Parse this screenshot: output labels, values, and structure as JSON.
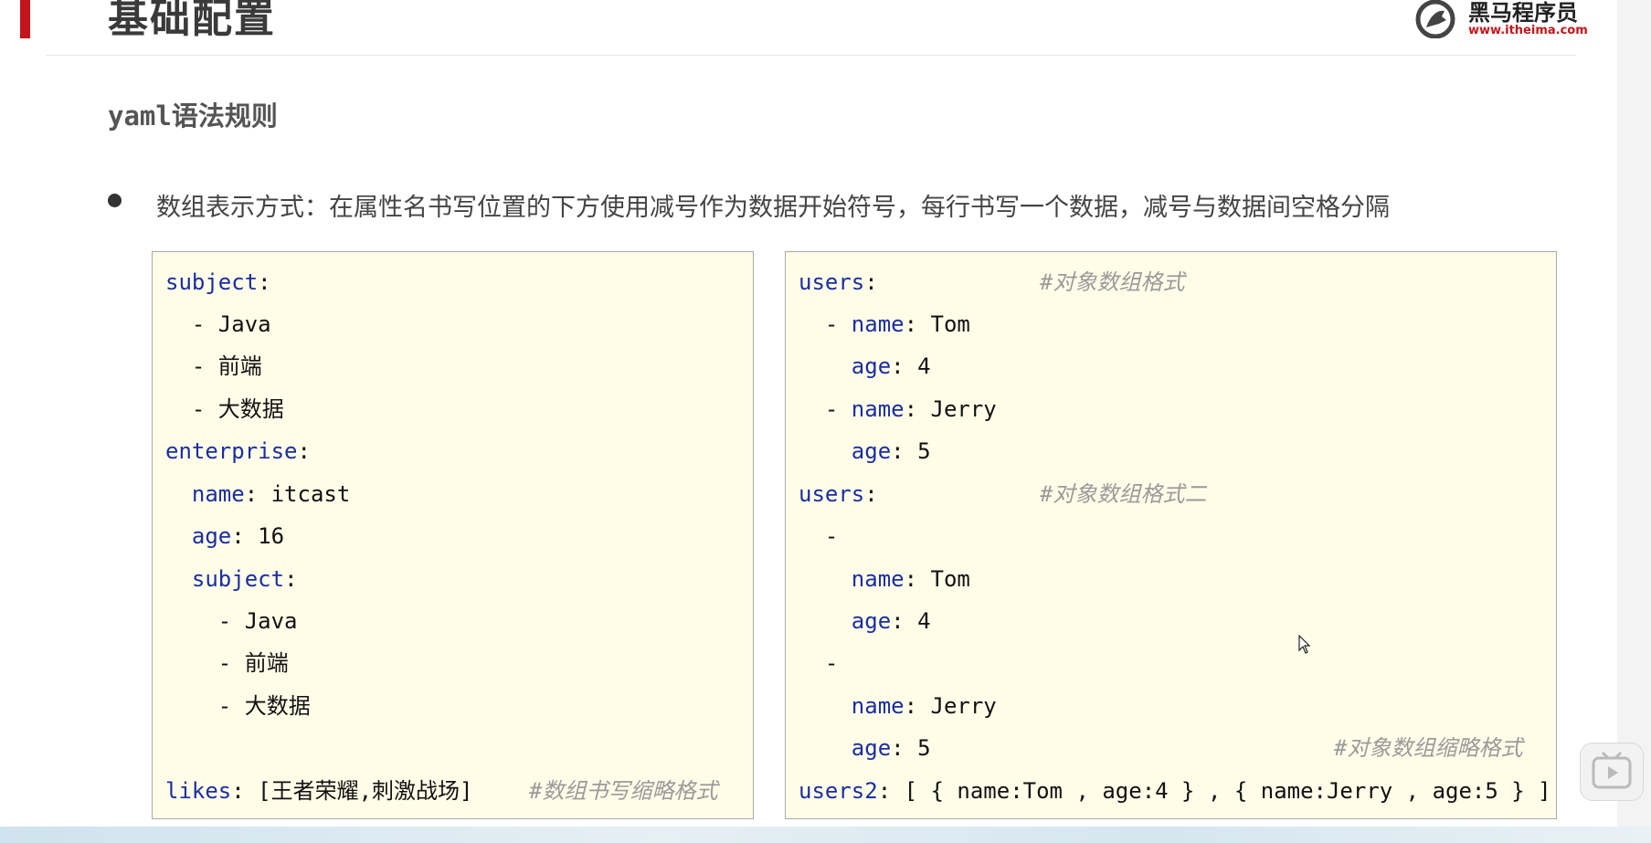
{
  "header": {
    "title": "基础配置",
    "logo_name": "黑马程序员",
    "logo_url": "www.itheima.com"
  },
  "section": {
    "title_code": "yaml",
    "title_cn": "语法规则"
  },
  "bullet": {
    "text": "数组表示方式：在属性名书写位置的下方使用减号作为数据开始符号，每行书写一个数据，减号与数据间空格分隔"
  },
  "left_code": {
    "l1_key": "subject",
    "l2_val": "Java",
    "l3_val": "前端",
    "l4_val": "大数据",
    "l5_key": "enterprise",
    "l6_key": "name",
    "l6_val": "itcast",
    "l7_key": "age",
    "l7_val": "16",
    "l8_key": "subject",
    "l9_val": "Java",
    "l10_val": "前端",
    "l11_val": "大数据",
    "l12_key": "likes",
    "l12_val": "[王者荣耀,刺激战场]",
    "l12_comment": "#数组书写缩略格式"
  },
  "right_code": {
    "r1_key": "users",
    "r1_comment": "#对象数组格式",
    "r2_key": "name",
    "r2_val": "Tom",
    "r3_key": "age",
    "r3_val": "4",
    "r4_key": "name",
    "r4_val": "Jerry",
    "r5_key": "age",
    "r5_val": "5",
    "r6_key": "users",
    "r6_comment": "#对象数组格式二",
    "r8_key": "name",
    "r8_val": "Tom",
    "r9_key": "age",
    "r9_val": "4",
    "r11_key": "name",
    "r11_val": "Jerry",
    "r12_key": "age",
    "r12_val": "5",
    "r12_comment": "#对象数组缩略格式",
    "r13_key": "users2",
    "r13_val": "[ { name:Tom , age:4 } , { name:Jerry , age:5 } ]"
  },
  "colors": {
    "accent_red": "#c3161c",
    "code_key_blue": "#1a2ea0",
    "code_bg": "#fffde8"
  }
}
